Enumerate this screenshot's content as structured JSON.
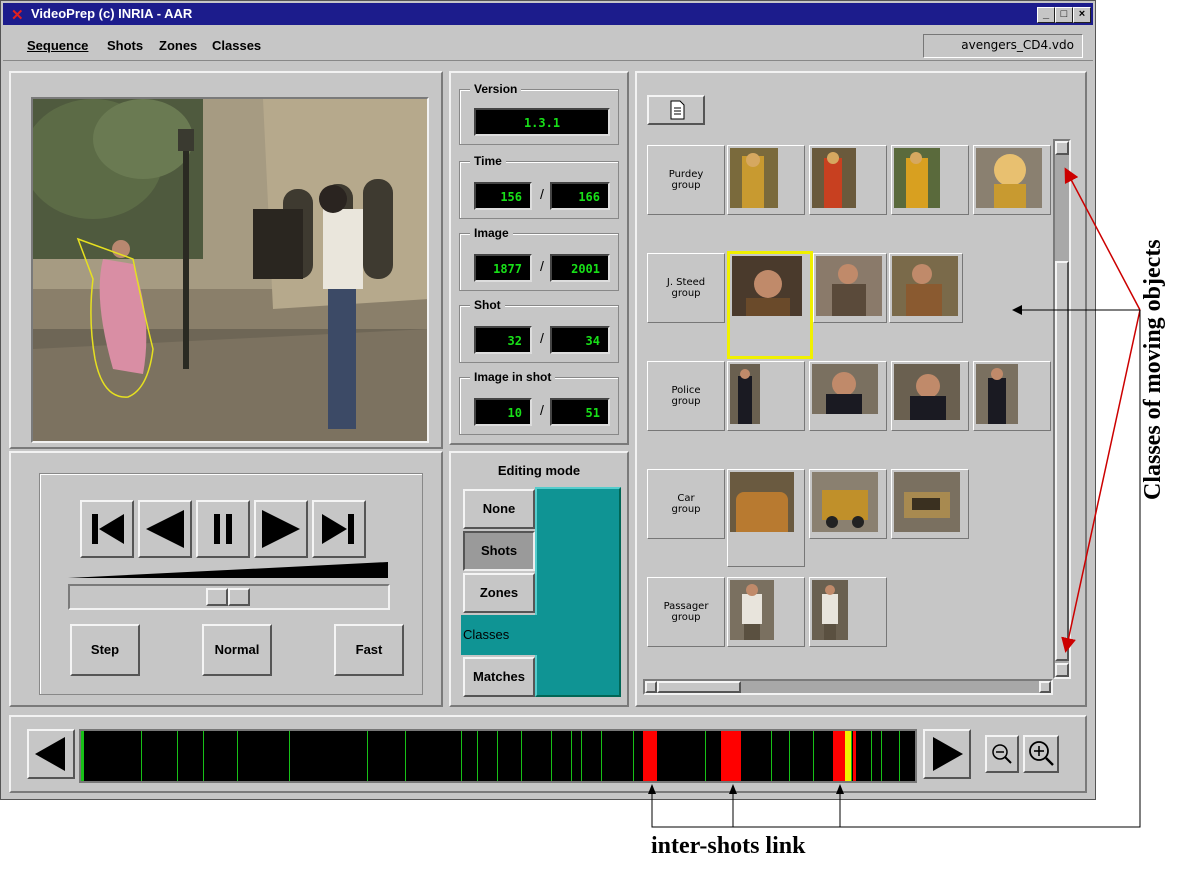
{
  "window": {
    "title": "VideoPrep (c) INRIA - AAR",
    "controls": [
      "_",
      "□",
      "×"
    ]
  },
  "menubar": {
    "items": [
      "Sequence",
      "Shots",
      "Zones",
      "Classes"
    ],
    "file": "avengers_CD4.vdo"
  },
  "info": {
    "version": {
      "label": "Version",
      "value": "1.3.1"
    },
    "time": {
      "label": "Time",
      "current": "156",
      "total": "166"
    },
    "image": {
      "label": "Image",
      "current": "1877",
      "total": "2001"
    },
    "shot": {
      "label": "Shot",
      "current": "32",
      "total": "34"
    },
    "image_in_shot": {
      "label": "Image in shot",
      "current": "10",
      "total": "51"
    },
    "separator": "/"
  },
  "playback": {
    "speed_buttons": {
      "step": "Step",
      "normal": "Normal",
      "fast": "Fast"
    }
  },
  "editing": {
    "title": "Editing mode",
    "modes": [
      "None",
      "Shots",
      "Zones",
      "Classes",
      "Matches"
    ],
    "selected": "Classes"
  },
  "classes": {
    "rows": [
      {
        "label": "Purdey group",
        "line1": "Purdey",
        "line2": "group",
        "thumb_count": 4
      },
      {
        "label": "J. Steed group",
        "line1": "J. Steed",
        "line2": "group",
        "thumb_count": 3
      },
      {
        "label": "Police group",
        "line1": "Police",
        "line2": "group",
        "thumb_count": 4
      },
      {
        "label": "Car group",
        "line1": "Car",
        "line2": "group",
        "thumb_count": 3
      },
      {
        "label": "Passager group",
        "line1": "Passager",
        "line2": "group",
        "thumb_count": 2
      }
    ]
  },
  "annotations": {
    "side": "Classes of moving objects",
    "bottom": "inter-shots link"
  },
  "colors": {
    "titlebar": "#1c1c8c",
    "lcd_text": "#18e018",
    "editing_accent": "#0f9494",
    "link_marker": "#ff0000",
    "arrow": "#cc0000"
  }
}
